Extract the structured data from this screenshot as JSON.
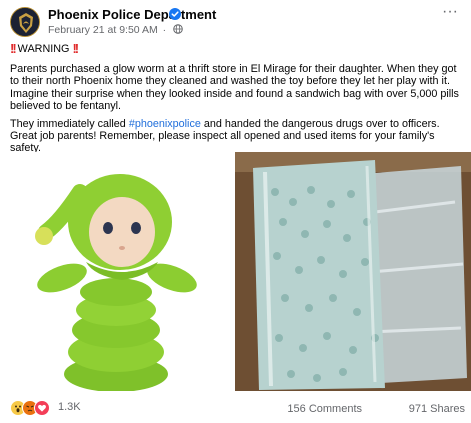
{
  "header": {
    "page_name": "Phoenix Police Department",
    "timestamp": "February 21 at 9:50 AM",
    "separator": "·",
    "verified_icon": "verified-badge-icon",
    "privacy_icon": "globe-icon",
    "more_label": "···"
  },
  "post": {
    "warning_text": "WARNING",
    "warning_marks": "!!",
    "paragraph1": "Parents purchased a glow worm at a thrift store in El Mirage for their daughter. When they got to their north Phoenix home they cleaned and washed the toy before they let her play with it. Imagine their surprise when they looked inside and found a sandwich bag with over 5,000 pills believed to be fentanyl.",
    "paragraph2_before": "They immediately called ",
    "hashtag": "#phoenixpolice",
    "paragraph2_after": " and handed the dangerous drugs over to officers. Great job parents! Remember, please inspect all opened and used items for your family's safety."
  },
  "photos": {
    "left_icon": "glow-worm-toy-photo",
    "right_icon": "bag-of-pills-photo"
  },
  "footer": {
    "reactions": [
      "wow",
      "angry",
      "love"
    ],
    "reaction_count": "1.3K",
    "comments": "156 Comments",
    "shares": "971 Shares"
  },
  "colors": {
    "accent": "#216fdb",
    "warning": "#e02b2b",
    "secondary_text": "#65676b"
  }
}
